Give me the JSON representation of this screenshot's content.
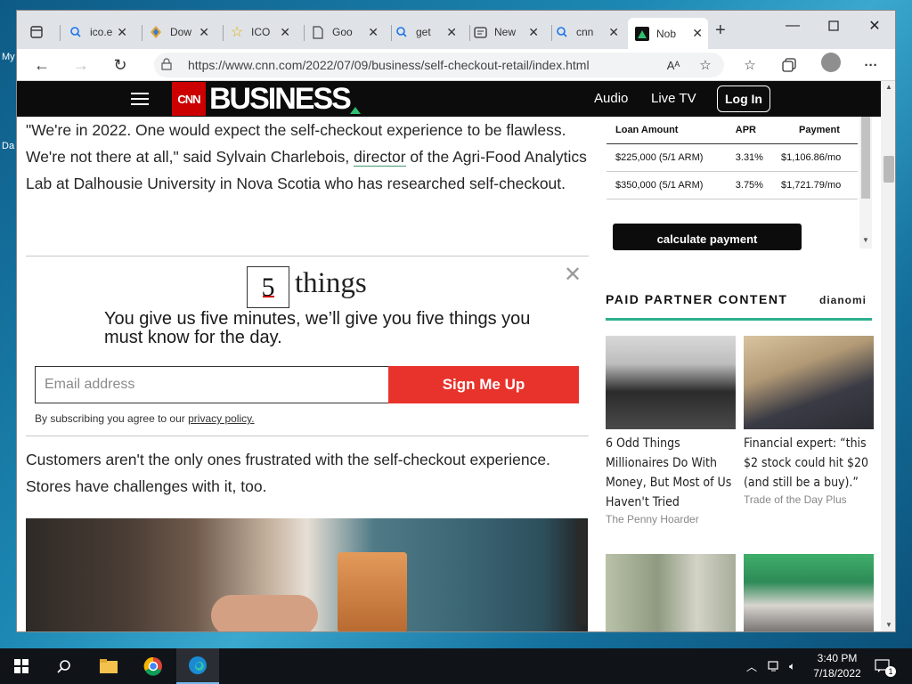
{
  "desktop": {
    "label_my": "My",
    "label_da": "Da"
  },
  "browser": {
    "tabs": [
      {
        "icon": "search-icon",
        "label": "ico.e"
      },
      {
        "icon": "download-icon",
        "label": "Dow"
      },
      {
        "icon": "star-icon",
        "label": "ICO"
      },
      {
        "icon": "document-icon",
        "label": "Goo"
      },
      {
        "icon": "search-icon",
        "label": "get"
      },
      {
        "icon": "newtab-icon",
        "label": "New"
      },
      {
        "icon": "search-icon",
        "label": "cnn"
      },
      {
        "icon": "cnn-icon",
        "label": "Nob"
      }
    ],
    "url": "https://www.cnn.com/2022/07/09/business/self-checkout-retail/index.html"
  },
  "cnn": {
    "logo_text": "CNN",
    "section": "BUSINESS",
    "nav_audio": "Audio",
    "nav_livetv": "Live TV",
    "login": "Log In"
  },
  "article": {
    "para1_a": "\"We're in 2022. One would expect the self-checkout experience to be flawless. We're not there at all,\" said Sylvain Charlebois, ",
    "para1_link": "director",
    "para1_b": " of the Agri-Food Analytics Lab at Dalhousie University in Nova Scotia who has researched self-checkout.",
    "para2": "Customers aren't the only ones frustrated with the self-checkout experience. Stores have challenges with it, too."
  },
  "newsletter": {
    "logo_number": "5",
    "logo_word": "things",
    "headline": "You give us five minutes, we’ll give you five things you must know for the day.",
    "email_placeholder": "Email address",
    "signup": "Sign Me Up",
    "disclaimer": "By subscribing you agree to our ",
    "privacy": "privacy policy."
  },
  "loan_table": {
    "headers": [
      "Loan Amount",
      "APR",
      "Payment"
    ],
    "rows": [
      [
        "$225,000 (5/1 ARM)",
        "3.31%",
        "$1,106.86/mo"
      ],
      [
        "$350,000 (5/1 ARM)",
        "3.75%",
        "$1,721.79/mo"
      ]
    ],
    "button": "calculate payment"
  },
  "partner": {
    "heading": "PAID PARTNER CONTENT",
    "provider": "dianomi",
    "cards": [
      {
        "title": "6 Odd Things Millionaires Do With Money, But Most of Us Haven't Tried",
        "source": "The Penny Hoarder"
      },
      {
        "title": "Financial expert: “this $2 stock could hit $20 (and still be a buy).”",
        "source": "Trade of the Day Plus"
      }
    ]
  },
  "taskbar": {
    "time": "3:40 PM",
    "date": "7/18/2022",
    "notifications": "1"
  }
}
